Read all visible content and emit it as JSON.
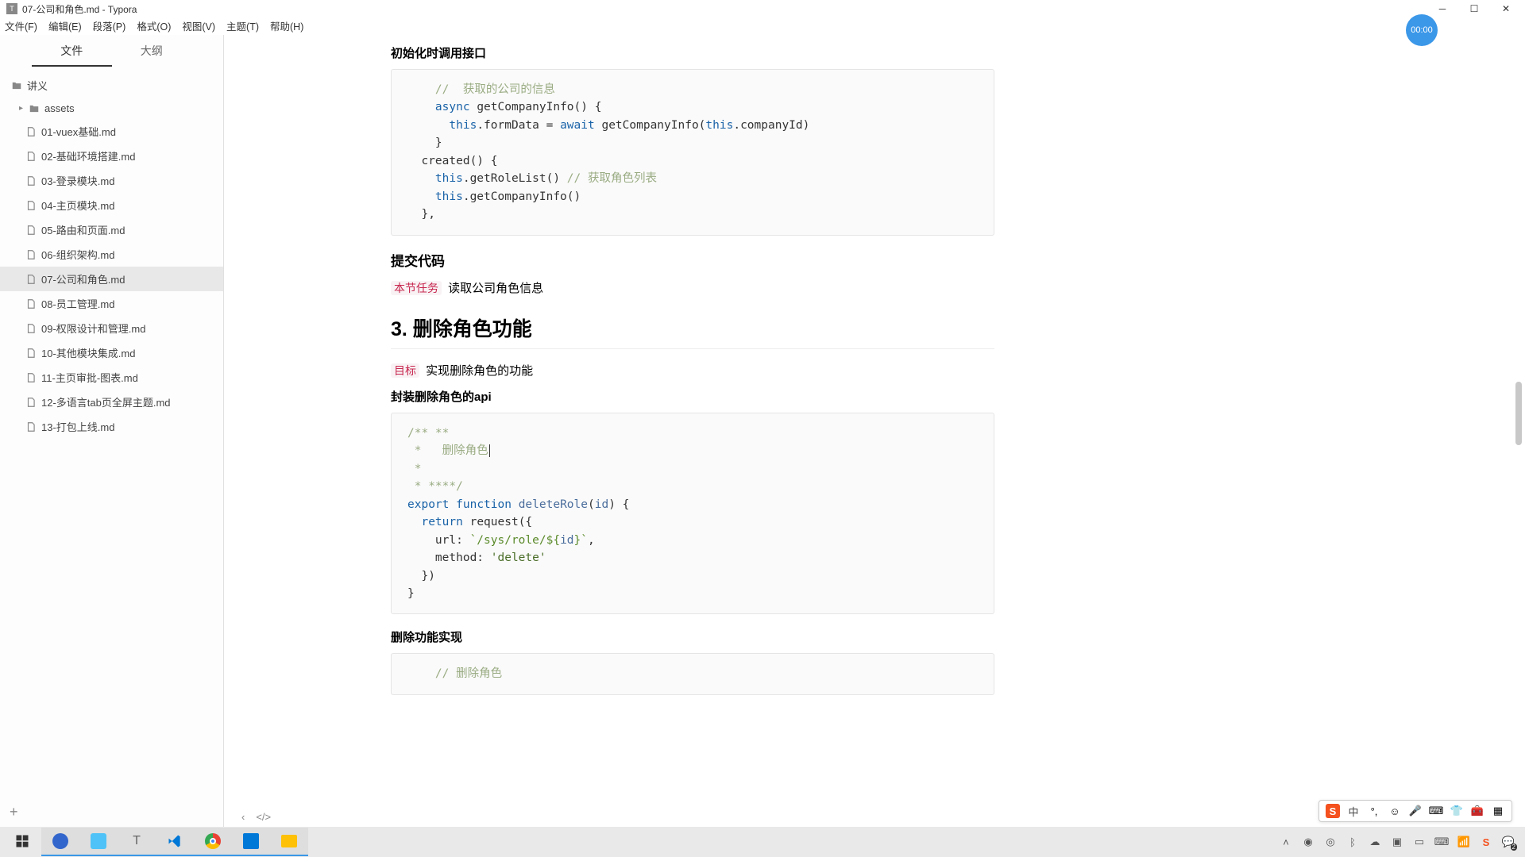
{
  "window": {
    "title": "07-公司和角色.md - Typora"
  },
  "menu": {
    "items": [
      "文件(F)",
      "编辑(E)",
      "段落(P)",
      "格式(O)",
      "视图(V)",
      "主题(T)",
      "帮助(H)"
    ]
  },
  "sidebar": {
    "tabs": {
      "files": "文件",
      "outline": "大纲"
    },
    "root": "讲义",
    "folder": "assets",
    "items": [
      "01-vuex基础.md",
      "02-基础环境搭建.md",
      "03-登录模块.md",
      "04-主页模块.md",
      "05-路由和页面.md",
      "06-组织架构.md",
      "07-公司和角色.md",
      "08-员工管理.md",
      "09-权限设计和管理.md",
      "10-其他模块集成.md",
      "11-主页审批-图表.md",
      "12-多语言tab页全屏主题.md",
      "13-打包上线.md"
    ],
    "selected_index": 6
  },
  "editor": {
    "h_init": "初始化时调用接口",
    "code1": {
      "c1": "//  获取的公司的信息",
      "l2a": "async",
      "l2b": "getCompanyInfo() {",
      "l3a": "this",
      "l3b": ".formData = ",
      "l3c": "await",
      "l3d": " getCompanyInfo(",
      "l3e": "this",
      "l3f": ".companyId)",
      "l4": "}",
      "l5": "created() {",
      "l6a": "this",
      "l6b": ".getRoleList() ",
      "l6c": "// 获取角色列表",
      "l7a": "this",
      "l7b": ".getCompanyInfo()",
      "l8": "},"
    },
    "h_submit": "提交代码",
    "task_label": "本节任务",
    "task_text": " 读取公司角色信息",
    "h_section": "3. 删除角色功能",
    "goal_label": "目标",
    "goal_text": " 实现删除角色的功能",
    "h_api": "封装删除角色的api",
    "code2": {
      "c1": "/** **",
      "c2": " *   删除角色",
      "c3": " *",
      "c4": " * ****/",
      "l1a": "export",
      "l1b": "function",
      "l1c": "deleteRole",
      "l1d": "(",
      "l1e": "id",
      "l1f": ") {",
      "l2a": "return",
      "l2b": " request({",
      "l3a": "url: ",
      "l3b": "`/sys/role/${",
      "l3c": "id",
      "l3d": "}`",
      "l3e": ",",
      "l4a": "method: ",
      "l4b": "'delete'",
      "l5": "})",
      "l6": "}"
    },
    "h_impl": "删除功能实现",
    "code3": {
      "c1": "// 删除角色"
    }
  },
  "bubble": {
    "time": "00:00"
  },
  "ime": {
    "logo": "S",
    "lang": "中"
  },
  "taskbar": {
    "notif_count": "2"
  }
}
